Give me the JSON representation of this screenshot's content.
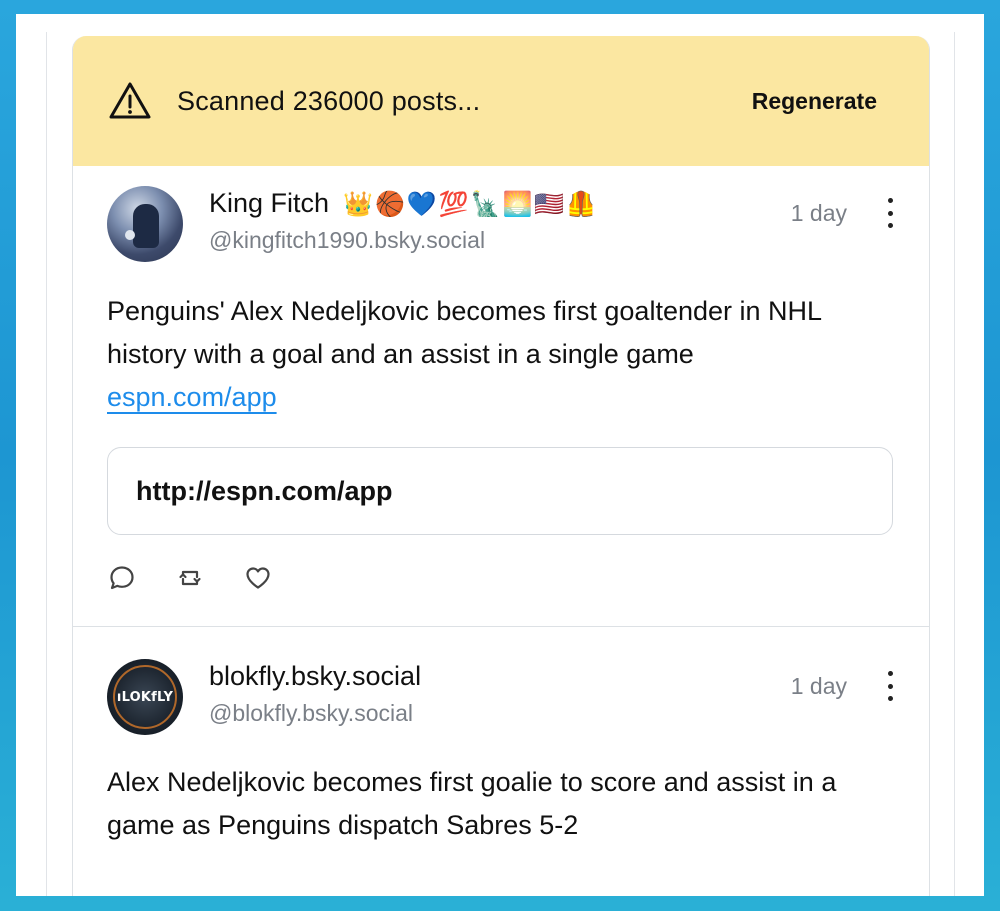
{
  "banner": {
    "icon": "warning-triangle-icon",
    "text": "Scanned 236000 posts...",
    "regenerate_label": "Regenerate",
    "background": "#fbe7a1"
  },
  "posts": [
    {
      "display_name": "King Fitch",
      "name_emojis": "👑🏀💙💯🗽🌅🇺🇸🦺",
      "handle": "@kingfitch1990.bsky.social",
      "time": "1 day",
      "text": "Penguins' Alex Nedeljkovic becomes first goaltender in NHL history with a goal and an assist in a single game",
      "link_text": "espn.com/app",
      "link_card_url": "http://espn.com/app",
      "actions": [
        "reply-icon",
        "repost-icon",
        "like-icon"
      ]
    },
    {
      "display_name": "blokfly.bsky.social",
      "handle": "@blokfly.bsky.social",
      "time": "1 day",
      "text": "Alex Nedeljkovic becomes first goalie to score and assist in a game as Penguins dispatch Sabres 5-2",
      "avatar_text": "ıLOKfLY"
    }
  ],
  "colors": {
    "link": "#1d8ceb",
    "muted_text": "#7a7f87",
    "banner": "#fbe7a1"
  }
}
